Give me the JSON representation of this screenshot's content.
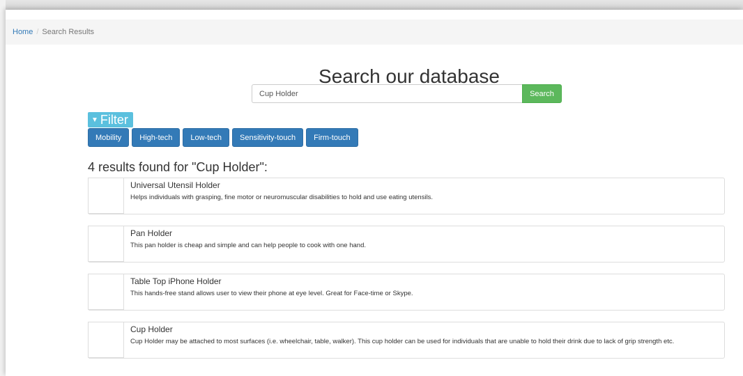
{
  "breadcrumb": {
    "home": "Home",
    "separator": "/",
    "current": "Search Results"
  },
  "heading": "Search our database",
  "search": {
    "value": "Cup Holder",
    "button": "Search"
  },
  "filter": {
    "toggle": "Filter",
    "tags": [
      "Mobility",
      "High-tech",
      "Low-tech",
      "Sensitivity-touch",
      "Firm-touch"
    ]
  },
  "results": {
    "summary": "4 results found for \"Cup Holder\":",
    "items": [
      {
        "title": "Universal Utensil Holder",
        "description": "Helps individuals with grasping, fine motor or neuromuscular disabilities to hold and use eating utensils."
      },
      {
        "title": "Pan Holder",
        "description": "This pan holder is cheap and simple and can help people to cook with one hand."
      },
      {
        "title": "Table Top iPhone Holder",
        "description": "This hands-free stand allows user to view their phone at eye level. Great for Face-time or Skype."
      },
      {
        "title": "Cup Holder",
        "description": "Cup Holder may be attached to most surfaces (i.e. wheelchair, table, walker). This cup holder can be used for individuals that are unable to hold their drink due to lack of grip strength etc."
      }
    ]
  },
  "colors": {
    "link": "#337ab7",
    "search_button": "#5cb85c",
    "filter_toggle": "#5bc0de",
    "tag_button": "#337ab7"
  },
  "icons": {
    "filter_caret": "caret-down-icon",
    "result_thumbnail": "image-placeholder-icon"
  }
}
